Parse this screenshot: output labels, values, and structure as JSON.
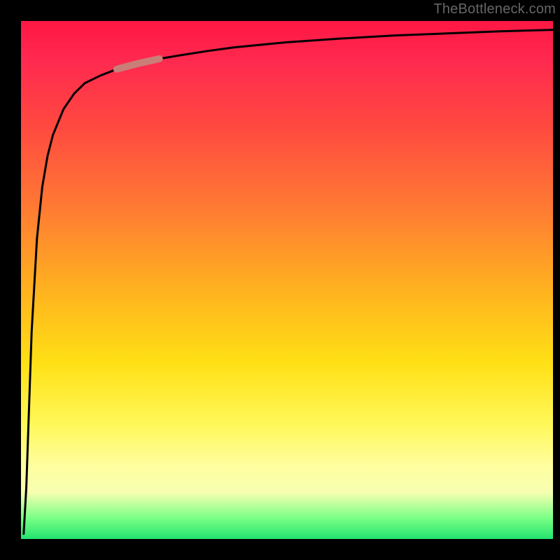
{
  "watermark": "TheBottleneck.com",
  "colors": {
    "frame_bg": "#000000",
    "gradient_top": "#ff1744",
    "gradient_mid1": "#ff7a33",
    "gradient_mid2": "#ffe015",
    "gradient_mid3": "#fffea0",
    "gradient_bottom": "#22e36e",
    "curve": "#000000",
    "highlight_segment": "#c97e78"
  },
  "chart_data": {
    "type": "line",
    "title": "",
    "xlabel": "",
    "ylabel": "",
    "xlim": [
      0,
      100
    ],
    "ylim": [
      0,
      100
    ],
    "legend": null,
    "grid": false,
    "annotations": [
      {
        "kind": "segment_highlight",
        "x_range": [
          18,
          26
        ],
        "color": "#c97e78",
        "stroke_width": 10
      }
    ],
    "series": [
      {
        "name": "curve",
        "color": "#000000",
        "x": [
          0.5,
          1,
          2,
          3,
          4,
          5,
          6,
          8,
          10,
          12,
          15,
          18,
          22,
          26,
          30,
          35,
          40,
          50,
          60,
          70,
          80,
          90,
          100
        ],
        "y": [
          1,
          10,
          40,
          58,
          68,
          74,
          78,
          83,
          86,
          88,
          89.5,
          90.7,
          91.8,
          92.7,
          93.4,
          94.2,
          94.9,
          95.9,
          96.6,
          97.2,
          97.6,
          98.0,
          98.3
        ]
      }
    ]
  }
}
